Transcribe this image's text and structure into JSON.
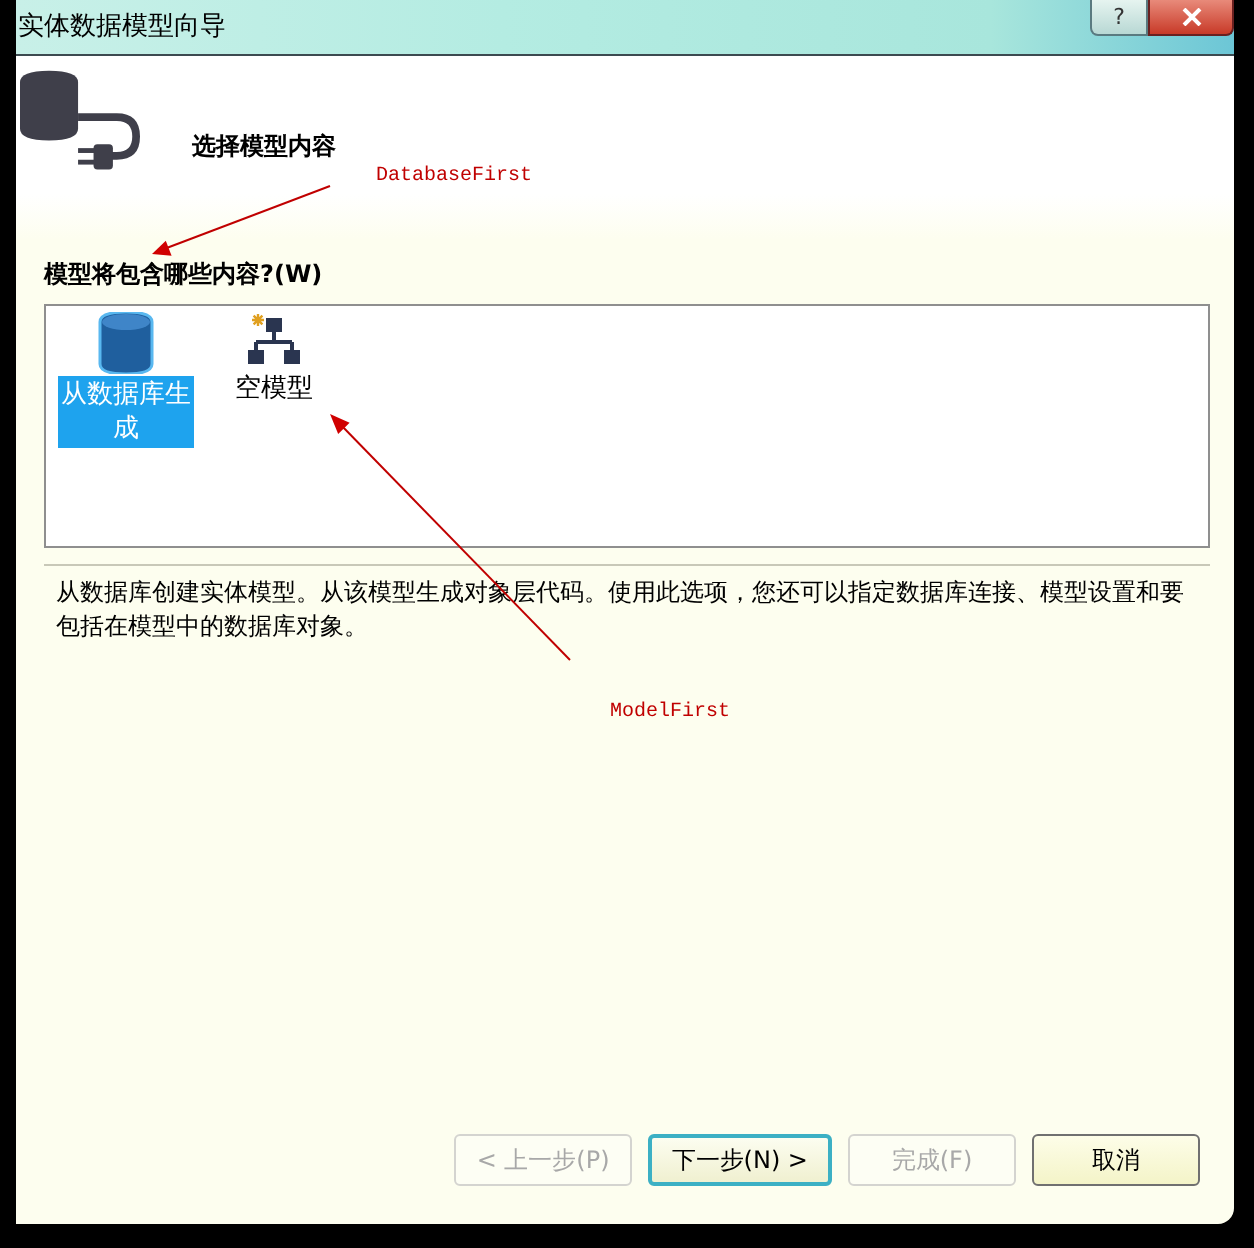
{
  "window": {
    "title": "实体数据模型向导",
    "help_button": "?"
  },
  "header": {
    "heading": "选择模型内容"
  },
  "content_label": "模型将包含哪些内容?(W)",
  "model_options": [
    {
      "label": "从数据库生成",
      "kind": "database",
      "selected": true
    },
    {
      "label": "空模型",
      "kind": "empty",
      "selected": false
    }
  ],
  "description": "从数据库创建实体模型。从该模型生成对象层代码。使用此选项，您还可以指定数据库连接、模型设置和要包括在模型中的数据库对象。",
  "buttons": [
    {
      "label": "< 上一步(P)",
      "disabled": true,
      "focused": false
    },
    {
      "label": "下一步(N) >",
      "disabled": false,
      "focused": true
    },
    {
      "label": "完成(F)",
      "disabled": true,
      "focused": false
    },
    {
      "label": "取消",
      "disabled": false,
      "focused": false
    }
  ],
  "annotations": [
    {
      "text": "DatabaseFirst"
    },
    {
      "text": "ModelFirst"
    }
  ]
}
